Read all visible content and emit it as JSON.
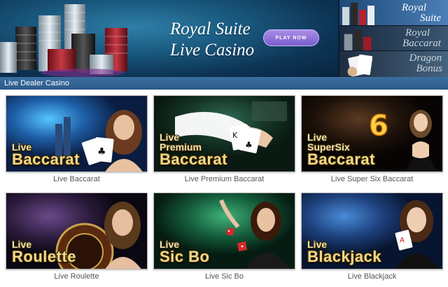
{
  "hero": {
    "title_line1": "Royal Suite",
    "title_line2": "Live Casino",
    "play_button": "PLAY NOW"
  },
  "sidebar": {
    "items": [
      {
        "line1": "Royal",
        "line2": "Suite"
      },
      {
        "line1": "Royal",
        "line2": "Baccarat"
      },
      {
        "line1": "Dragon",
        "line2": "Bonus"
      }
    ]
  },
  "section_title": "Live Dealer Casino",
  "games": [
    {
      "top": "Live",
      "mid": "",
      "main": "Baccarat",
      "caption": "Live Baccarat"
    },
    {
      "top": "Live",
      "mid": "Premium",
      "main": "Baccarat",
      "caption": "Live Premium Baccarat"
    },
    {
      "top": "Live",
      "mid": "SuperSix",
      "main": "Baccarat",
      "caption": "Live Super Six Baccarat",
      "badge": "6"
    },
    {
      "top": "Live",
      "mid": "",
      "main": "Roulette",
      "caption": "Live Roulette"
    },
    {
      "top": "Live",
      "mid": "",
      "main": "Sic Bo",
      "caption": "Live Sic Bo"
    },
    {
      "top": "Live",
      "mid": "",
      "main": "Blackjack",
      "caption": "Live Blackjack"
    }
  ],
  "colors": {
    "section_bar": "#2b5a88",
    "title_gold": "#f3d88a",
    "caption": "#555555",
    "play_button": "#7b5ccc"
  }
}
